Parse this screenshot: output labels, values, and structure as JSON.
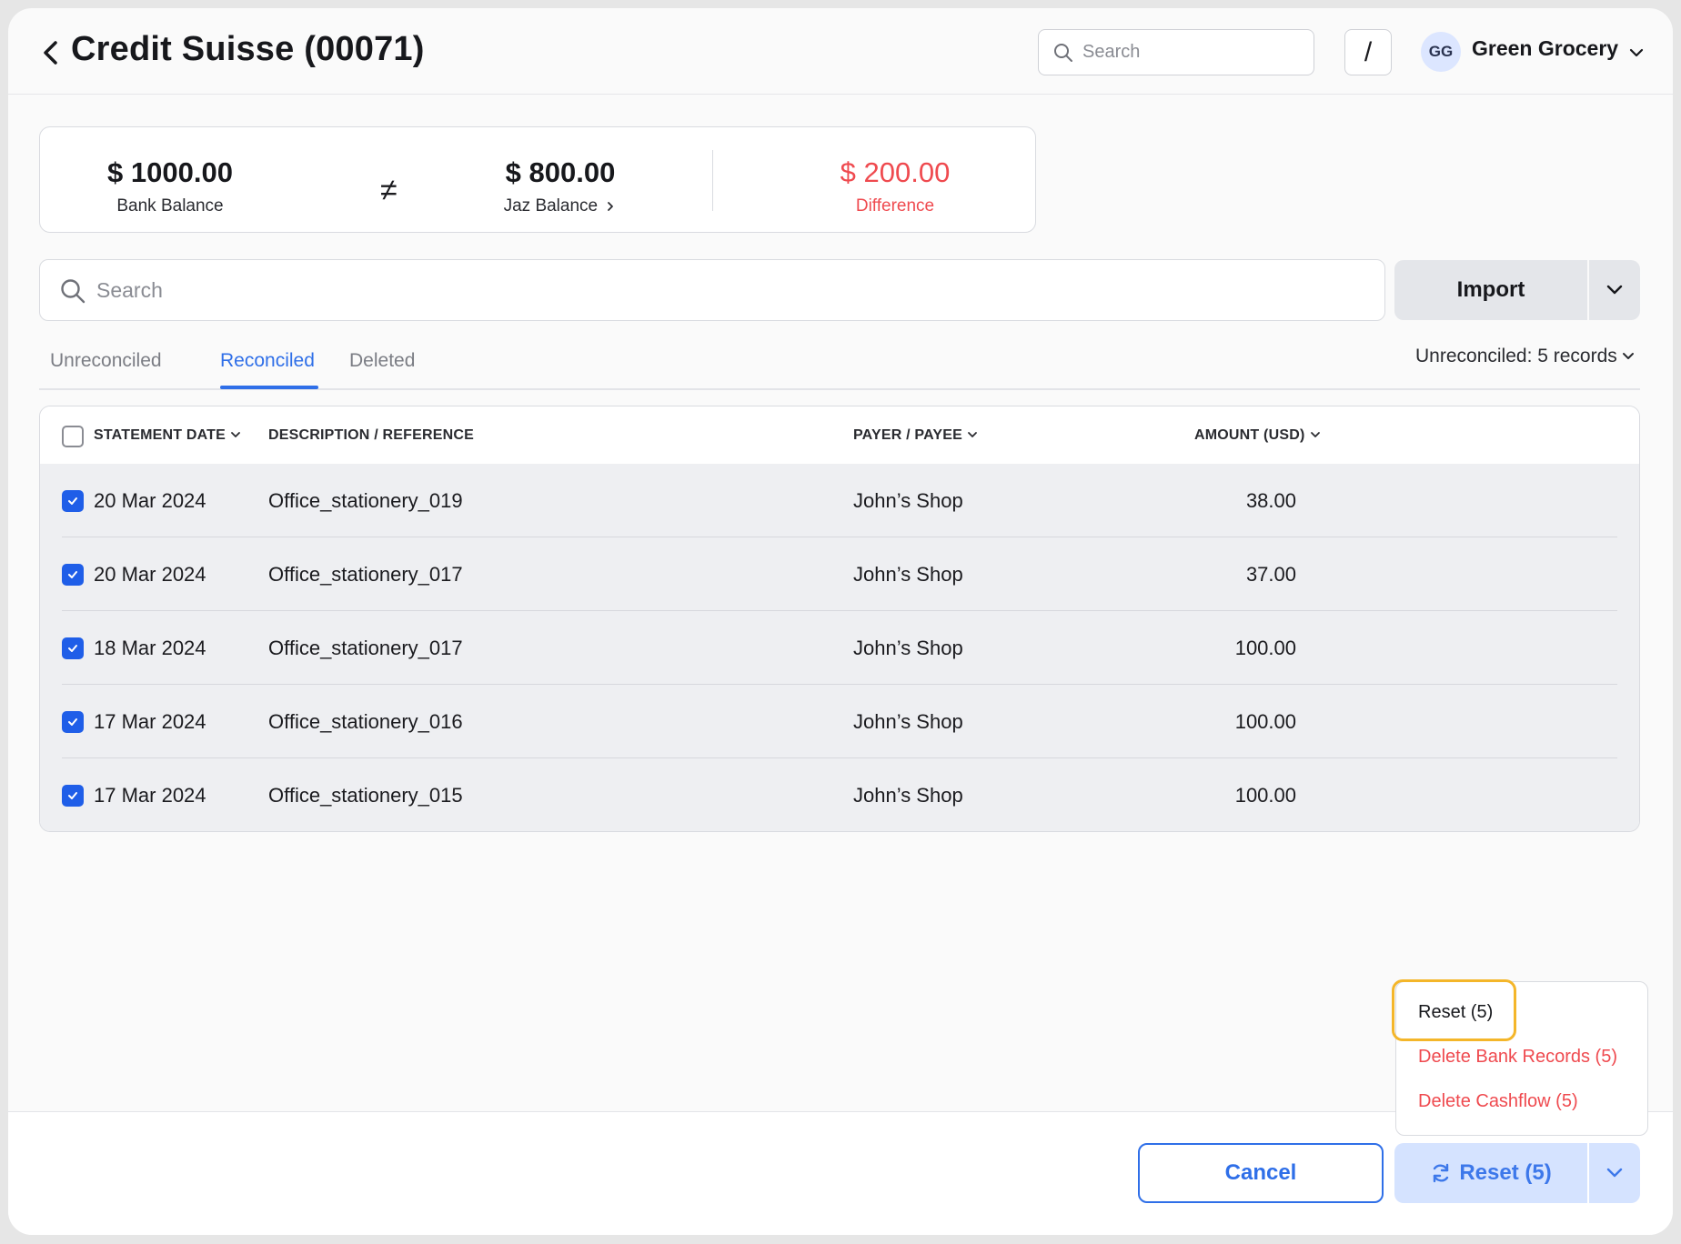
{
  "header": {
    "title": "Credit Suisse (00071)",
    "search_placeholder": "Search",
    "slash_label": "/",
    "avatar_initials": "GG",
    "org_name": "Green Grocery"
  },
  "balances": {
    "bank_amount": "$ 1000.00",
    "bank_label": "Bank Balance",
    "not_equal_symbol": "≠",
    "jaz_amount": "$ 800.00",
    "jaz_label": "Jaz Balance",
    "diff_amount": "$ 200.00",
    "diff_label": "Difference",
    "diff_color": "#ef4a4f"
  },
  "main_search_placeholder": "Search",
  "import_label": "Import",
  "tabs": [
    {
      "label": "Unreconciled",
      "active": false
    },
    {
      "label": "Reconciled",
      "active": true
    },
    {
      "label": "Deleted",
      "active": false
    }
  ],
  "records_selector": "Unreconciled: 5 records",
  "table": {
    "columns": [
      "STATEMENT DATE",
      "DESCRIPTION / REFERENCE",
      "PAYER / PAYEE",
      "AMOUNT (USD)"
    ],
    "rows": [
      {
        "date": "20 Mar 2024",
        "description": "Office_stationery_019",
        "payee": "John’s Shop",
        "amount": "38.00",
        "checked": true
      },
      {
        "date": "20 Mar 2024",
        "description": "Office_stationery_017",
        "payee": "John’s Shop",
        "amount": "37.00",
        "checked": true
      },
      {
        "date": "18 Mar 2024",
        "description": "Office_stationery_017",
        "payee": "John’s Shop",
        "amount": "100.00",
        "checked": true
      },
      {
        "date": "17 Mar 2024",
        "description": "Office_stationery_016",
        "payee": "John’s Shop",
        "amount": "100.00",
        "checked": true
      },
      {
        "date": "17 Mar 2024",
        "description": "Office_stationery_015",
        "payee": "John’s Shop",
        "amount": "100.00",
        "checked": true
      }
    ]
  },
  "menu": {
    "items": [
      {
        "label": "Reset (5)",
        "danger": false
      },
      {
        "label": "Delete Bank Records (5)",
        "danger": true
      },
      {
        "label": "Delete Cashflow (5)",
        "danger": true
      }
    ]
  },
  "footer": {
    "cancel_label": "Cancel",
    "reset_label": "Reset (5)"
  },
  "colors": {
    "accent": "#2f6fe8",
    "checkbox": "#1f5ee8",
    "danger": "#ef4a4f",
    "focus_ring": "#f4b62a"
  },
  "icons": {
    "back": "chevron-left-icon",
    "search": "search-icon",
    "caret": "chevron-down-icon",
    "jaz_link": "chevron-right-icon",
    "reset": "refresh-icon",
    "check": "check-icon"
  }
}
